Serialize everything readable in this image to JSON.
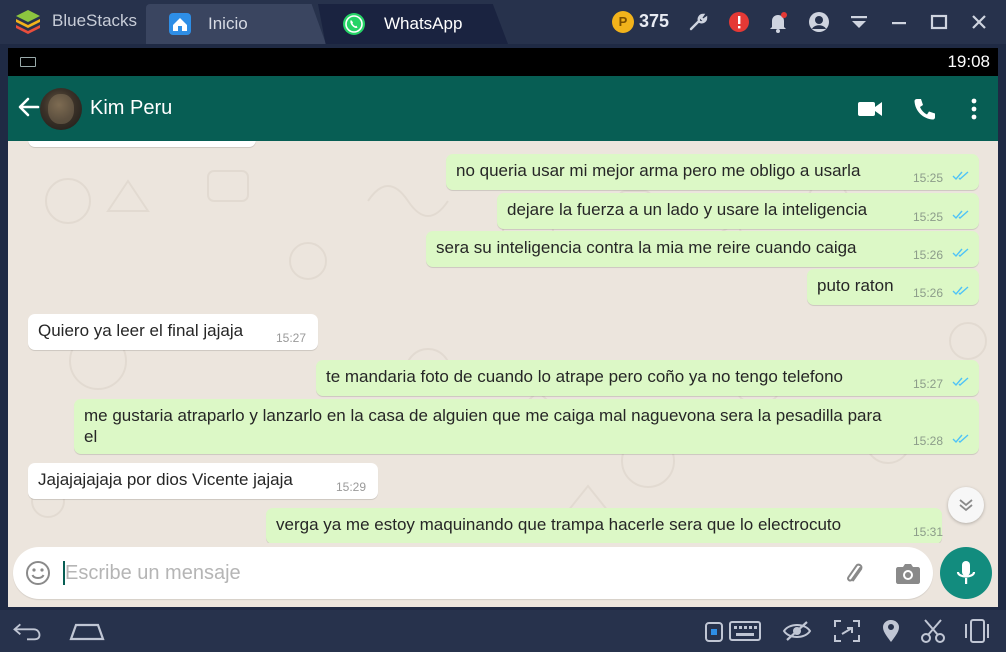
{
  "bluestacks": {
    "brand": "BlueStacks",
    "tabs": [
      {
        "label": "Inicio",
        "active": false
      },
      {
        "label": "WhatsApp",
        "active": true
      }
    ],
    "coins": "375",
    "toolbar_icons": [
      "wrench-icon",
      "alert-icon",
      "bell-icon",
      "account-icon",
      "dropdown-icon",
      "minimize-icon",
      "maximize-icon",
      "close-icon"
    ]
  },
  "status_bar": {
    "time": "19:08"
  },
  "chat_header": {
    "contact_name": "Kim Peru"
  },
  "messages": [
    {
      "direction": "out",
      "text": "no queria usar mi mejor arma pero me obligo a usarla",
      "time": "15:25",
      "read": true
    },
    {
      "direction": "out",
      "text": "dejare la fuerza a un lado y usare la inteligencia",
      "time": "15:25",
      "read": true
    },
    {
      "direction": "out",
      "text": "sera su inteligencia contra la mia me reire cuando caiga",
      "time": "15:26",
      "read": true
    },
    {
      "direction": "out",
      "text": "puto raton",
      "time": "15:26",
      "read": true
    },
    {
      "direction": "in",
      "text": "Quiero ya leer el final jajaja",
      "time": "15:27"
    },
    {
      "direction": "out",
      "text": "te mandaria foto de cuando lo atrape pero coño ya no tengo telefono",
      "time": "15:27",
      "read": true
    },
    {
      "direction": "out",
      "text": "me gustaria atraparlo y lanzarlo en la casa de alguien que me caiga mal naguevona sera la pesadilla para",
      "text_line2": "el",
      "time": "15:28",
      "read": true
    },
    {
      "direction": "in",
      "text": "Jajajajajaja por dios Vicente jajaja",
      "time": "15:29"
    },
    {
      "direction": "out",
      "text": "verga ya me estoy maquinando que trampa hacerle sera que lo electrocuto",
      "time": "15:31",
      "read": true
    }
  ],
  "composer": {
    "placeholder": "Escribe un mensaje"
  },
  "colors": {
    "header": "#075e54",
    "outgoing_bubble": "#dcf8c6",
    "incoming_bubble": "#ffffff",
    "chat_background": "#ece5dd",
    "read_ticks": "#4fc3f7",
    "fab": "#128c7e"
  }
}
